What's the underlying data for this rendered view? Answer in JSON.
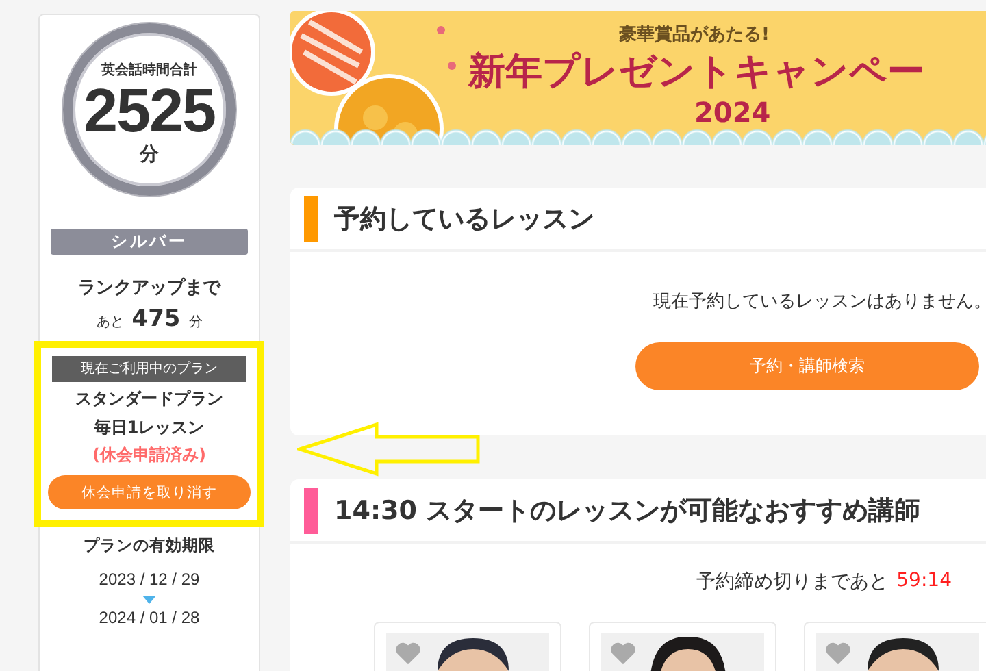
{
  "sidebar": {
    "total_label": "英会話時間合計",
    "total_minutes": "2525",
    "total_unit": "分",
    "rank": "シルバー",
    "rank_up_label": "ランクアップまで",
    "remaining_prefix": "あと",
    "remaining": "475",
    "remaining_unit": "分",
    "plan": {
      "header": "現在ご利用中のプラン",
      "name": "スタンダードプラン",
      "lessons": "毎日1レッスン",
      "status": "(休会申請済み)",
      "button": "休会申請を取り消す",
      "highlighted": true
    },
    "expiry": {
      "label": "プランの有効期限",
      "from": "2023 / 12 / 29",
      "to": "2024 / 01 / 28"
    }
  },
  "banner": {
    "tagline": "豪華賞品があたる!",
    "title": "新年プレゼントキャンペー",
    "year": "2024"
  },
  "annotation_arrow": true,
  "reservations": {
    "title": "予約しているレッスン",
    "empty": "現在予約しているレッスンはありません。",
    "button": "予約・講師検索"
  },
  "recommended": {
    "title": "14:30 スタートのレッスンが可能なおすすめ講師",
    "deadline_label": "予約締め切りまであと",
    "deadline": "59:14"
  }
}
